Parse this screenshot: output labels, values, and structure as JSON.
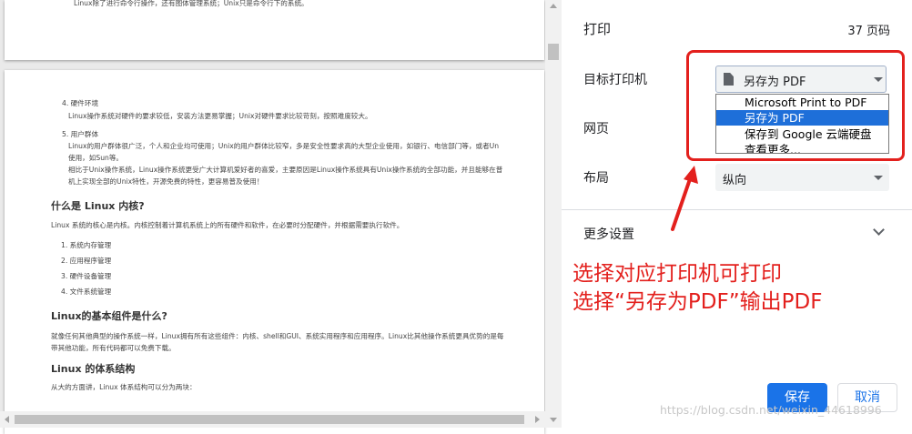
{
  "preview": {
    "page1_line": "Linux除了进行命令行操作，还有图体管理系统；Unix只是命令行下的系统。",
    "lines": [
      "4. 硬件环境",
      "Linux操作系统对硬件的要求较低，安装方法更易掌握；Unix对硬件要求比较苛刻，按照难度较大。",
      "5. 用户群体",
      "Linux的用户群体很广泛，个人和企业均可使用；Unix的用户群体比较窄，多是安全性要求高的大型企业使用，如银行、电信部门等，或者Un",
      "使用，如Sun等。",
      "相比于Unix操作系统，Linux操作系统更受广大计算机爱好者的喜爱，主要原因是Linux操作系统具有Unix操作系统的全部功能，并且能够在普",
      "机上实现全部的Unix特性，开源免费的特性，更容易普及使用！"
    ],
    "heading1": "什么是 Linux 内核?",
    "para1": "Linux 系统的核心是内核。内核控制着计算机系统上的所有硬件和软件，在必要时分配硬件，并根据需要执行软件。",
    "kernel_list": [
      "1. 系统内存管理",
      "2. 应用程序管理",
      "3. 硬件设备管理",
      "4. 文件系统管理"
    ],
    "heading2": "Linux的基本组件是什么?",
    "para2a": "就像任何其他典型的操作系统一样，Linux拥有所有这些组件：内核、shell和GUI、系统实用程序和应用程序。Linux比其他操作系统更具优势的是每",
    "para2b": "带其他功能，所有代码都可以免费下载。",
    "heading3": "Linux 的体系结构",
    "para3": "从大的方面讲，Linux 体系结构可以分为两块："
  },
  "panel": {
    "title": "打印",
    "page_count": "37 页码",
    "dest_label": "目标打印机",
    "dest_value": "另存为 PDF",
    "dropdown_options": [
      "Microsoft Print to PDF",
      "另存为 PDF",
      "保存到 Google 云端硬盘",
      "查看更多..."
    ],
    "pages_label": "网页",
    "layout_label": "布局",
    "layout_value": "纵向",
    "more_settings": "更多设置",
    "save_label": "保存",
    "cancel_label": "取消"
  },
  "annotation": {
    "line1": "选择对应打印机可打印",
    "line2": "选择“另存为PDF”输出PDF",
    "color": "#e3201d"
  },
  "watermark": "https://blog.csdn.net/weixin_44618996",
  "colors": {
    "accent": "#1a73e8",
    "selected_option": "#1e6fd9"
  }
}
